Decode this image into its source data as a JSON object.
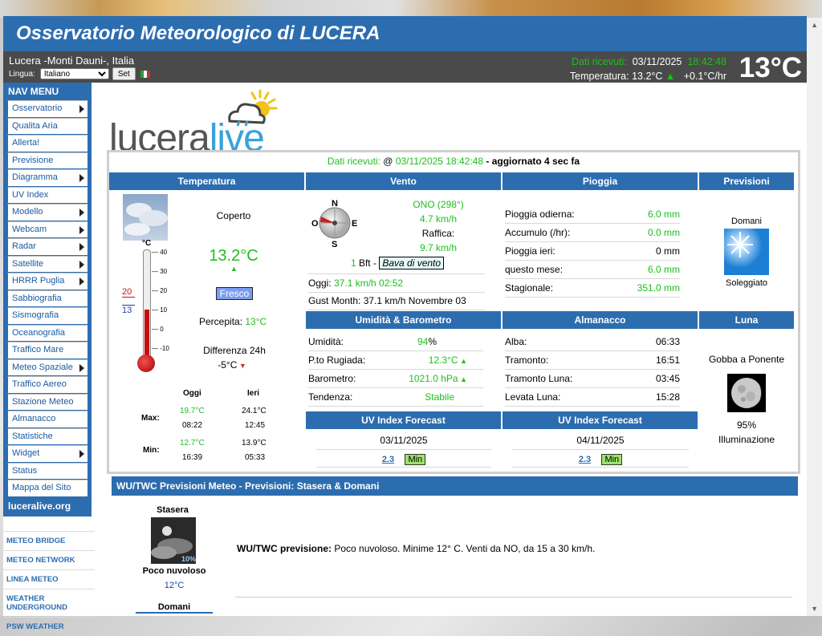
{
  "site_title": "Osservatorio Meteorologico di LUCERA",
  "location": "Lucera -Monti Dauni-, Italia",
  "lang_label": "Lingua:",
  "lang_selected": "Italiano",
  "set_label": "Set",
  "header_right": {
    "recv_label": "Dati ricevuti:",
    "date": "03/11/2025",
    "time": "18:42:48",
    "temp_label": "Temperatura:",
    "temp_value": "13.2°C",
    "trend": "+0.1°C/hr",
    "big_temp": "13°C"
  },
  "nav": {
    "title": "NAV MENU",
    "items": [
      "Osservatorio",
      "Qualita Aria",
      "Allerta!",
      "Previsione",
      "Diagramma",
      "UV Index",
      "Modello",
      "Webcam",
      "Radar",
      "Satellite",
      "HRRR Puglia",
      "Sabbiografia",
      "Sismografia",
      "Oceanografia",
      "Traffico Mare",
      "Meteo Spaziale",
      "Traffico Aereo",
      "Stazione Meteo",
      "Almanacco",
      "Statistiche",
      "Widget",
      "Status",
      "Mappa del Sito"
    ],
    "site": "luceralive.org",
    "links": [
      "METEO BRIDGE",
      "METEO NETWORK",
      "LINEA METEO",
      "WEATHER UNDERGROUND",
      "PSW WEATHER"
    ]
  },
  "logo": {
    "part1": "lucera",
    "part2": "live"
  },
  "received": {
    "label": "Dati ricevuti:",
    "at": "@",
    "datetime": "03/11/2025 18:42:48",
    "updated": "- aggiornato 4 sec fa"
  },
  "temperature": {
    "head": "Temperatura",
    "condition": "Coperto",
    "value": "13.2°C",
    "badge": "Fresco",
    "perceived_label": "Percepita:",
    "perceived_value": "13°C",
    "diff_label": "Differenza 24h",
    "diff_value": "-5°C",
    "unit": "°C",
    "scale": [
      "40",
      "30",
      "20",
      "10",
      "0",
      "-10"
    ],
    "marker_high": "20",
    "marker_low": "13",
    "table": {
      "today": "Oggi",
      "yesterday": "Ieri",
      "max": "Max:",
      "min": "Min:",
      "max_today": "19.7°C",
      "max_today_time": "08:22",
      "max_yest": "24.1°C",
      "max_yest_time": "12:45",
      "min_today": "12.7°C",
      "min_today_time": "16:39",
      "min_yest": "13.9°C",
      "min_yest_time": "05:33"
    }
  },
  "wind": {
    "head": "Vento",
    "dir": "ONO (298°)",
    "speed": "4.7 km/h",
    "gust_label": "Raffica:",
    "gust": "9.7 km/h",
    "bft_num": "1",
    "bft_label": "Bft -",
    "bft_desc": "Bava di vento",
    "today_label": "Oggi:",
    "today_value": "37.1 km/h 02:52",
    "month": "Gust Month: 37.1 km/h Novembre 03",
    "compass": {
      "n": "N",
      "s": "S",
      "e": "E",
      "o": "O"
    }
  },
  "rain": {
    "head": "Pioggia",
    "rows": [
      {
        "label": "Pioggia odierna:",
        "value": "6.0 mm"
      },
      {
        "label": "Accumulo (/hr):",
        "value": "0.0 mm"
      },
      {
        "label": "Pioggia ieri:",
        "value": "0 mm"
      },
      {
        "label": "questo mese:",
        "value": "6.0 mm"
      },
      {
        "label": "Stagionale:",
        "value": "351.0 mm"
      }
    ]
  },
  "forecast": {
    "head": "Previsioni",
    "day": "Domani",
    "desc": "Soleggiato"
  },
  "humidity": {
    "head": "Umidità & Barometro",
    "rows": [
      {
        "label": "Umidità:",
        "value": "94",
        "unit": "%"
      },
      {
        "label": "P.to Rugiada:",
        "value": "12.3°C"
      },
      {
        "label": "Barometro:",
        "value": "1021.0 hPa"
      },
      {
        "label": "Tendenza:",
        "value": "Stabile"
      }
    ]
  },
  "almanac": {
    "head": "Almanacco",
    "rows": [
      {
        "label": "Alba:",
        "value": "06:33"
      },
      {
        "label": "Tramonto:",
        "value": "16:51"
      },
      {
        "label": "Tramonto Luna:",
        "value": "03:45"
      },
      {
        "label": "Levata Luna:",
        "value": "15:28"
      }
    ]
  },
  "moon": {
    "head": "Luna",
    "phase": "Gobba a Ponente",
    "pct": "95%",
    "illum": "Illuminazione"
  },
  "uv1": {
    "head": "UV Index Forecast",
    "date": "03/11/2025",
    "value": "2.3",
    "level": "Min"
  },
  "uv2": {
    "head": "UV Index Forecast",
    "date": "04/11/2025",
    "value": "2.3",
    "level": "Min"
  },
  "wu": {
    "head": "WU/TWC Previsioni Meteo  - Previsioni: Stasera & Domani",
    "tonight": "Stasera",
    "tonight_desc": "Poco nuvoloso",
    "tonight_temp": "12°C",
    "tonight_pct": "10%",
    "next": "Domani",
    "text_label": "WU/TWC previsione:",
    "text": " Poco nuvoloso. Minime 12° C. Venti da NO, da 15 a 30 km/h."
  }
}
